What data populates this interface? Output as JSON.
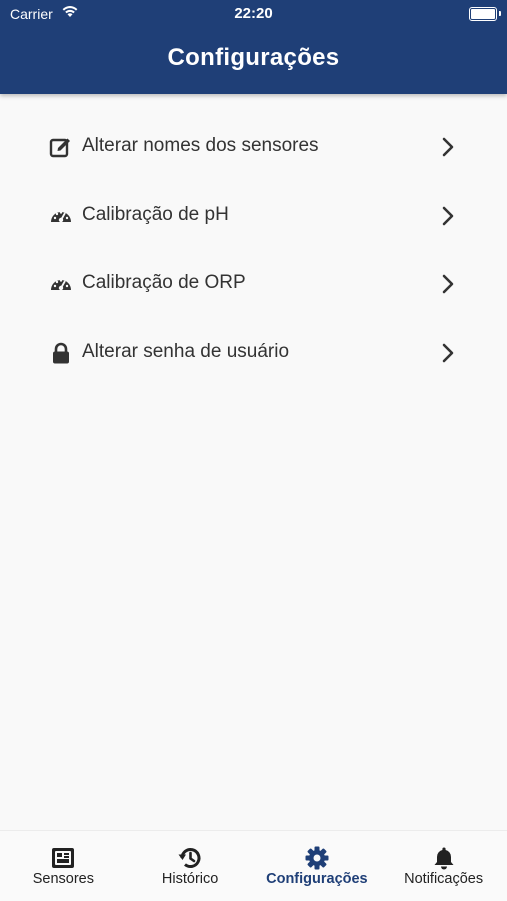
{
  "status": {
    "carrier": "Carrier",
    "time": "22:20"
  },
  "header": {
    "title": "Configurações"
  },
  "menu": {
    "items": [
      {
        "label": "Alterar nomes dos sensores",
        "icon": "edit-icon"
      },
      {
        "label": "Calibração de pH",
        "icon": "gauge-icon"
      },
      {
        "label": "Calibração de ORP",
        "icon": "gauge-icon"
      },
      {
        "label": "Alterar senha de usuário",
        "icon": "lock-icon"
      }
    ]
  },
  "tabbar": {
    "tabs": [
      {
        "label": "Sensores",
        "icon": "sensor-board-icon"
      },
      {
        "label": "Histórico",
        "icon": "history-icon"
      },
      {
        "label": "Configurações",
        "icon": "gear-icon",
        "active": true
      },
      {
        "label": "Notificações",
        "icon": "bell-icon"
      }
    ]
  },
  "colors": {
    "primary": "#1f3f77",
    "background": "#f9f9f9",
    "text": "#333333"
  }
}
